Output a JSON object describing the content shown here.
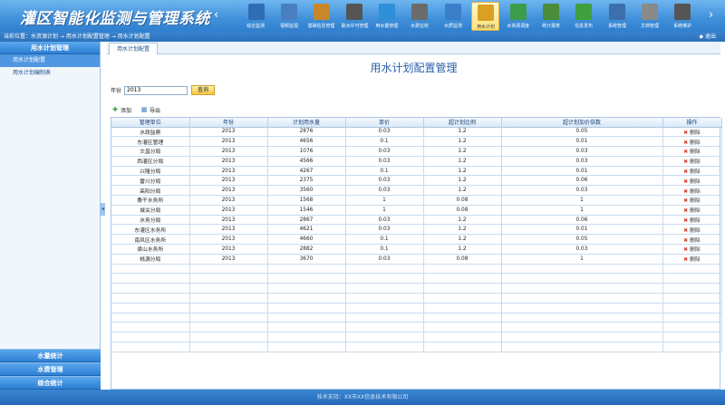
{
  "app": {
    "title": "灌区智能化监测与管理系统"
  },
  "toolbar": {
    "items": [
      {
        "label": "综合监测",
        "icon": "monitor-icon",
        "color": "#2f6db5"
      },
      {
        "label": "视频监视",
        "icon": "camera-icon",
        "color": "#4a7fbf"
      },
      {
        "label": "基础信息管理",
        "icon": "document-icon",
        "color": "#c9872b"
      },
      {
        "label": "取水许可管理",
        "icon": "safe-icon",
        "color": "#555555"
      },
      {
        "label": "用水量管理",
        "icon": "water-icon",
        "color": "#2f8fd9"
      },
      {
        "label": "水费征收",
        "icon": "ledger-icon",
        "color": "#6b6b6b"
      },
      {
        "label": "水质监测",
        "icon": "flask-icon",
        "color": "#3a7dc9"
      },
      {
        "label": "用水计划",
        "icon": "plan-icon",
        "color": "#d9a021",
        "active": true
      },
      {
        "label": "水资源调度",
        "icon": "bottle-icon",
        "color": "#3b9c4a"
      },
      {
        "label": "统计报表",
        "icon": "report-icon",
        "color": "#4a8c3a"
      },
      {
        "label": "信息发布",
        "icon": "info-icon",
        "color": "#3f9f3f"
      },
      {
        "label": "系统管理",
        "icon": "system-icon",
        "color": "#3d6fae"
      },
      {
        "label": "文档管理",
        "icon": "doc-icon",
        "color": "#8a8a8a"
      },
      {
        "label": "系统维护",
        "icon": "tools-icon",
        "color": "#555555"
      }
    ]
  },
  "crumb": {
    "text": "当前位置：水资源计划 → 用水计划配置管理 → 用水计划配置",
    "exit": "退出"
  },
  "sidebar": {
    "header": "用水计划管理",
    "items": [
      {
        "label": "用水计划配置",
        "active": true
      },
      {
        "label": "用水计划编制表"
      }
    ],
    "bottom": [
      "水量统计",
      "水费管理",
      "综合统计"
    ]
  },
  "tab": {
    "label": "用水计划配置"
  },
  "page": {
    "title": "用水计划配置管理",
    "year_label": "年份",
    "year_value": "2013",
    "query_label": "查询",
    "add_label": "添加",
    "export_label": "导出"
  },
  "table": {
    "columns": [
      "管理单位",
      "年份",
      "计划用水量",
      "单价",
      "超计划比例",
      "超计划加价倍数",
      "操作"
    ],
    "rows": [
      [
        "水政监察",
        "2013",
        "2876",
        "0.03",
        "1.2",
        "0.05",
        "删除"
      ],
      [
        "东灌区管理",
        "2013",
        "4656",
        "0.1",
        "1.2",
        "0.01",
        "删除"
      ],
      [
        "文昌分局",
        "2013",
        "1076",
        "0.03",
        "1.2",
        "0.03",
        "删除"
      ],
      [
        "西灌区分局",
        "2013",
        "4566",
        "0.03",
        "1.2",
        "0.03",
        "删除"
      ],
      [
        "兴隆分局",
        "2013",
        "4267",
        "0.1",
        "1.2",
        "0.01",
        "删除"
      ],
      [
        "雷川分局",
        "2013",
        "2375",
        "0.03",
        "1.2",
        "0.06",
        "删除"
      ],
      [
        "高阳分局",
        "2013",
        "3560",
        "0.03",
        "1.2",
        "0.03",
        "删除"
      ],
      [
        "桑干水务所",
        "2013",
        "1568",
        "1",
        "0.08",
        "1",
        "删除"
      ],
      [
        "城关分局",
        "2013",
        "1546",
        "1",
        "0.08",
        "1",
        "删除"
      ],
      [
        "水务分局",
        "2013",
        "2867",
        "0.03",
        "1.2",
        "0.06",
        "删除"
      ],
      [
        "东灌区水务所",
        "2013",
        "4621",
        "0.03",
        "1.2",
        "0.01",
        "删除"
      ],
      [
        "南风区水务所",
        "2013",
        "4660",
        "0.1",
        "1.2",
        "0.05",
        "删除"
      ],
      [
        "梁山水务所",
        "2013",
        "2882",
        "0.1",
        "1.2",
        "0.03",
        "删除"
      ],
      [
        "桃源分局",
        "2013",
        "3670",
        "0.03",
        "0.08",
        "1",
        "删除"
      ]
    ],
    "empty_rows": 9
  },
  "footer": {
    "text": "技术支持：XX市XX信息技术有限公司"
  }
}
